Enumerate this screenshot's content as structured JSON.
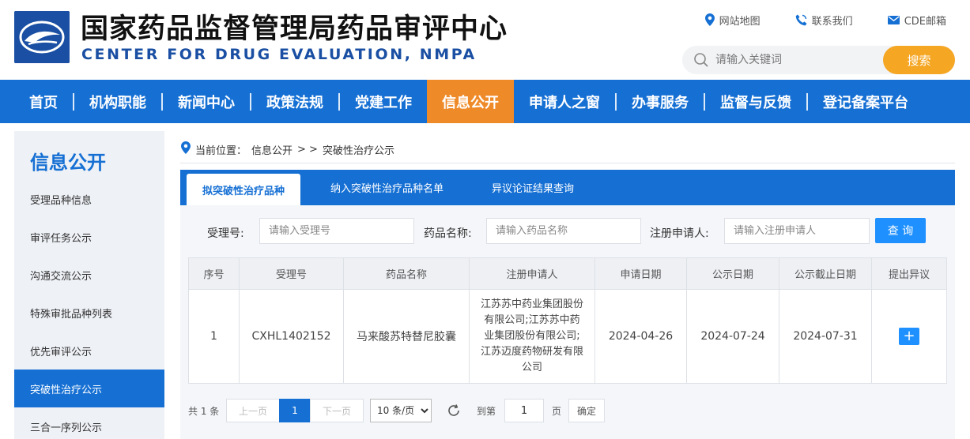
{
  "header": {
    "title_cn": "国家药品监督管理局药品审评中心",
    "title_en": "CENTER FOR DRUG EVALUATION, NMPA",
    "top_links": [
      {
        "label": "网站地图",
        "icon": "location-pin-icon"
      },
      {
        "label": "联系我们",
        "icon": "phone-icon"
      },
      {
        "label": "CDE邮箱",
        "icon": "mail-icon"
      }
    ],
    "search": {
      "placeholder": "请输入关键词",
      "button": "搜索"
    }
  },
  "nav": {
    "items": [
      "首页",
      "机构职能",
      "新闻中心",
      "政策法规",
      "党建工作",
      "信息公开",
      "申请人之窗",
      "办事服务",
      "监督与反馈",
      "登记备案平台"
    ],
    "active": "信息公开"
  },
  "sidebar": {
    "title": "信息公开",
    "items": [
      "受理品种信息",
      "审评任务公示",
      "沟通交流公示",
      "特殊审批品种列表",
      "优先审评公示",
      "突破性治疗公示",
      "三合一序列公示"
    ],
    "active": "突破性治疗公示"
  },
  "breadcrumb": {
    "prefix": "当前位置：",
    "parent": "信息公开",
    "sep": "> >",
    "current": "突破性治疗公示"
  },
  "tabs": [
    "拟突破性治疗品种",
    "纳入突破性治疗品种名单",
    "异议论证结果查询"
  ],
  "filters": {
    "accept_no_label": "受理号:",
    "accept_no_placeholder": "请输入受理号",
    "drug_name_label": "药品名称:",
    "drug_name_placeholder": "请输入药品名称",
    "applicant_label": "注册申请人:",
    "applicant_placeholder": "请输入注册申请人",
    "query_button": "查 询"
  },
  "table": {
    "headers": [
      "序号",
      "受理号",
      "药品名称",
      "注册申请人",
      "申请日期",
      "公示日期",
      "公示截止日期",
      "提出异议"
    ],
    "rows": [
      {
        "no": "1",
        "accept_no": "CXHL1402152",
        "drug_name": "马来酸苏特替尼胶囊",
        "applicant": "江苏苏中药业集团股份有限公司;江苏苏中药业集团股份有限公司;江苏迈度药物研发有限公司",
        "apply_date": "2024-04-26",
        "publicity_date": "2024-07-24",
        "deadline": "2024-07-31",
        "objection": "+"
      }
    ]
  },
  "pager": {
    "total": "共 1 条",
    "prev": "上一页",
    "current_page": "1",
    "next": "下一页",
    "page_size": "10 条/页",
    "goto_label": "到第",
    "goto_value": "1",
    "page_unit": "页",
    "confirm": "确定"
  },
  "colors": {
    "brand_blue": "#1670d4",
    "active_orange": "#ef8a28",
    "search_orange": "#f5a623"
  }
}
